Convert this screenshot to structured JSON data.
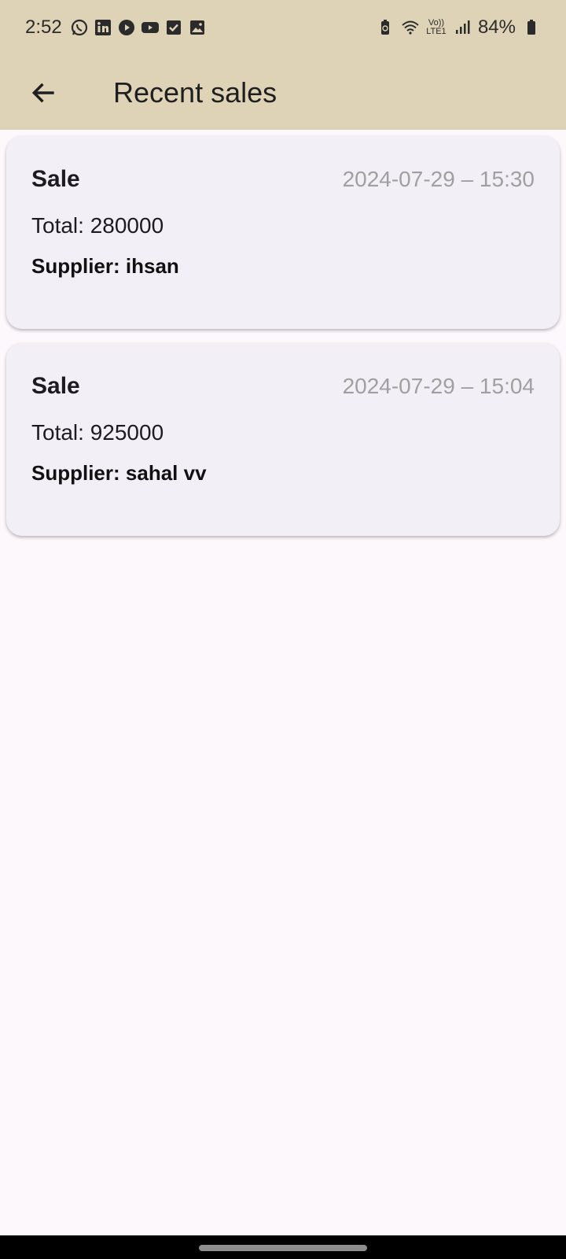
{
  "status_bar": {
    "time": "2:52",
    "battery_percent": "84%",
    "network_label": "Vo)) LTE1",
    "left_icons": [
      "whatsapp-icon",
      "linkedin-icon",
      "play-icon",
      "youtube-icon",
      "checkbox-icon",
      "gallery-icon"
    ],
    "right_icons": [
      "battery-saver-icon",
      "wifi-icon",
      "signal-icon",
      "battery-icon"
    ]
  },
  "app_bar": {
    "title": "Recent sales",
    "back_icon": "arrow-left-icon"
  },
  "colors": {
    "app_bar_bg": "#dfd3b7",
    "page_bg": "#fdf8fc",
    "card_bg": "#f2eff7",
    "date_text": "#a0a0a0"
  },
  "sales": [
    {
      "title": "Sale",
      "datetime": "2024-07-29 – 15:30",
      "total": "Total: 280000",
      "supplier": "Supplier: ihsan"
    },
    {
      "title": "Sale",
      "datetime": "2024-07-29 – 15:04",
      "total": "Total: 925000",
      "supplier": "Supplier: sahal vv"
    }
  ]
}
